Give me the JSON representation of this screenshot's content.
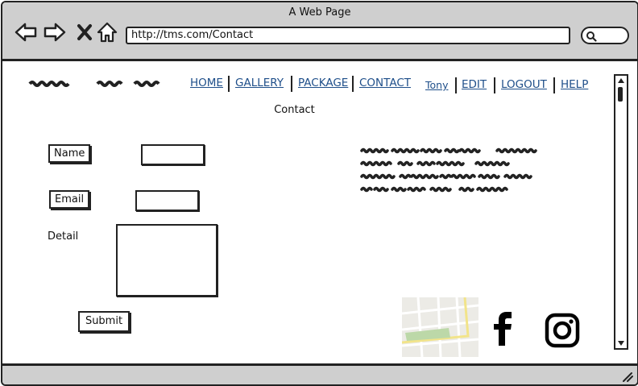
{
  "window": {
    "title": "A Web Page"
  },
  "browser": {
    "url": "http://tms.com/Contact",
    "icons": [
      "back-arrow-icon",
      "forward-arrow-icon",
      "close-icon",
      "home-icon",
      "search-icon"
    ]
  },
  "nav": {
    "items": [
      "HOME",
      "GALLERY",
      "PACKAGE",
      "CONTACT",
      "Tony",
      "EDIT",
      "LOGOUT",
      "HELP"
    ]
  },
  "page": {
    "heading": "Contact"
  },
  "form": {
    "name_label": "Name",
    "email_label": "Email",
    "detail_label": "Detail",
    "submit_label": "Submit"
  },
  "colors": {
    "chrome": "#cfcfcf",
    "link": "#1f4f8a",
    "stroke": "#222222"
  }
}
